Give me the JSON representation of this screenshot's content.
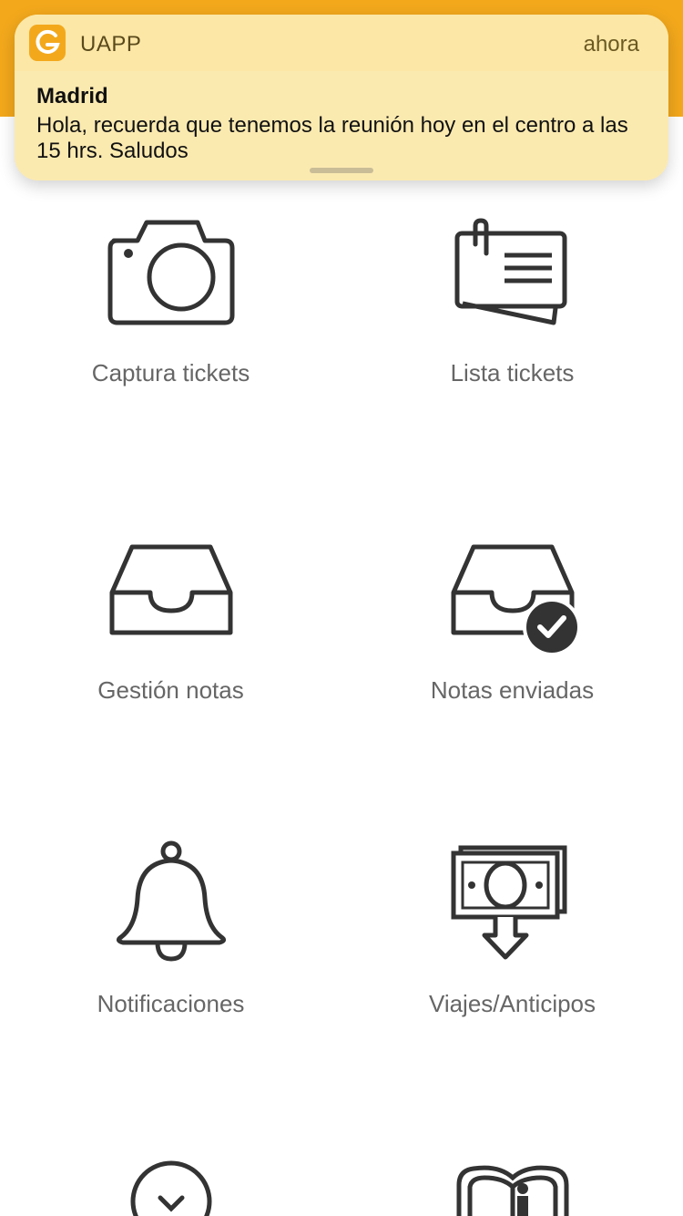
{
  "notification": {
    "app_name": "UAPP",
    "time": "ahora",
    "title": "Madrid",
    "message": "Hola, recuerda que tenemos la reunión hoy en el centro a las 15 hrs. Saludos",
    "logo_icon": "uapp-logo-icon"
  },
  "menu": {
    "items": [
      {
        "label": "Captura tickets",
        "icon": "camera-icon"
      },
      {
        "label": "Lista tickets",
        "icon": "ticket-list-icon"
      },
      {
        "label": "Gestión notas",
        "icon": "inbox-tray-icon"
      },
      {
        "label": "Notas enviadas",
        "icon": "inbox-check-icon"
      },
      {
        "label": "Notificaciones",
        "icon": "bell-icon"
      },
      {
        "label": "Viajes/Anticipos",
        "icon": "money-download-icon"
      }
    ],
    "partial_icons": [
      "circle-check-icon",
      "book-info-icon"
    ]
  },
  "colors": {
    "accent": "#f3a81c",
    "notification_bg": "#fbeab0",
    "icon": "#333333",
    "label": "#666666"
  }
}
